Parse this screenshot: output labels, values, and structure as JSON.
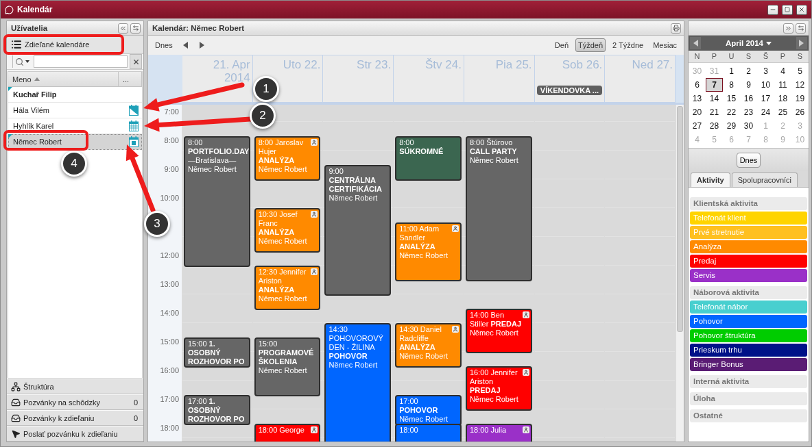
{
  "window": {
    "title": "Kalendár"
  },
  "users_panel": {
    "title": "Užívatelia",
    "shared_button": "Zdieľané kalendáre",
    "columns": [
      "Meno",
      "..."
    ],
    "users": [
      {
        "name": "Kuchař Filip",
        "current": true,
        "marked": true,
        "selected": false,
        "kind": "none"
      },
      {
        "name": "Hála Vilém",
        "current": false,
        "marked": false,
        "selected": false,
        "kind": "shared"
      },
      {
        "name": "Hyhlík Karel",
        "current": false,
        "marked": false,
        "selected": false,
        "kind": "grid"
      },
      {
        "name": "Němec Robert",
        "current": false,
        "marked": true,
        "selected": true,
        "kind": "date"
      }
    ],
    "footer": [
      {
        "label": "Štruktúra",
        "kind": "structure"
      },
      {
        "label": "Pozvánky na schôdzky",
        "count": "0",
        "kind": "inbox"
      },
      {
        "label": "Pozvánky k zdieľaniu",
        "count": "0",
        "kind": "inbox"
      },
      {
        "label": "Poslať pozvánku k zdieľaniu",
        "kind": "send"
      }
    ]
  },
  "calendar": {
    "title": "Kalendár: Němec Robert",
    "today_button": "Dnes",
    "views": [
      {
        "label": "Deň",
        "selected": false
      },
      {
        "label": "Týždeň",
        "selected": true
      },
      {
        "label": "2 Týždne",
        "selected": false
      },
      {
        "label": "Mesiac",
        "selected": false
      }
    ],
    "hours": [
      "7:00",
      "8:00",
      "9:00",
      "10:00",
      "12:00",
      "13:00",
      "14:00",
      "15:00",
      "16:00",
      "17:00",
      "18:00"
    ],
    "days": [
      {
        "label": "21. Apr 2014",
        "events": [
          {
            "time": "8:00",
            "title": "**PORTFOLIO.DAY** —Bratislava—",
            "owner": "Němec Robert",
            "color": "#666666",
            "contact": false
          },
          {
            "time": "15:00",
            "title": "**1. OSOBNÝ ROZHOVOR PO**",
            "color": "#666666",
            "contact": false
          },
          {
            "time": "17:00",
            "title": "**1. OSOBNÝ ROZHOVOR PO**",
            "color": "#666666",
            "contact": false
          }
        ]
      },
      {
        "label": "Uto 22.",
        "events": [
          {
            "time": "8:00",
            "title": "Jaroslav Hujer **ANALÝZA**",
            "owner": "Němec Robert",
            "color": "#ff8a00",
            "contact": true
          },
          {
            "time": "10:30",
            "title": "Josef Franc **ANALÝZA**",
            "owner": "Němec Robert",
            "color": "#ff8a00",
            "contact": true
          },
          {
            "time": "12:30",
            "title": "Jennifer Ariston **ANALÝZA**",
            "owner": "Němec Robert",
            "color": "#ff8a00",
            "contact": true
          },
          {
            "time": "15:00",
            "title": "**PROGRAMOVÉ ŠKOLENIA**",
            "owner": "Němec Robert",
            "color": "#666666",
            "contact": false
          },
          {
            "time": "18:00",
            "title": "George",
            "color": "#ff0000",
            "contact": true
          }
        ]
      },
      {
        "label": "Str 23.",
        "events": [
          {
            "time": "9:00",
            "title": "**CENTRÁLNA CERTIFIKÁCIA**",
            "owner": "Němec Robert",
            "color": "#666666",
            "contact": false
          },
          {
            "time": "14:30",
            "title": "POHOVOROVÝ DEN - ŽILINA **POHOVOR**",
            "owner": "Němec Robert",
            "color": "#0066ff",
            "contact": false
          }
        ]
      },
      {
        "label": "Štv 24.",
        "events": [
          {
            "time": "8:00",
            "title": "**SÚKROMNÉ**",
            "color": "#3b6650",
            "contact": false
          },
          {
            "time": "11:00",
            "title": "Adam Sandler **ANALÝZA**",
            "owner": "Němec Robert",
            "color": "#ff8a00",
            "contact": true
          },
          {
            "time": "14:30",
            "title": "Daniel Radcliffe **ANALÝZA**",
            "owner": "Němec Robert",
            "color": "#ff8a00",
            "contact": true
          },
          {
            "time": "17:00",
            "title": "**POHOVOR**",
            "owner": "Němec Robert",
            "color": "#0066ff",
            "contact": false
          },
          {
            "time": "18:00",
            "color": "#0066ff",
            "contact": false
          }
        ]
      },
      {
        "label": "Pia 25.",
        "events": [
          {
            "time": "8:00",
            "title": "Štúrovo **CALL PARTY**",
            "owner": "Němec Robert",
            "color": "#666666",
            "contact": false
          },
          {
            "time": "14:00",
            "title": "Ben Stiller **PREDAJ**",
            "owner": "Němec Robert",
            "color": "#ff0000",
            "contact": true
          },
          {
            "time": "16:00",
            "title": "Jennifer Ariston **PREDAJ**",
            "owner": "Němec Robert",
            "color": "#ff0000",
            "contact": true
          },
          {
            "time": "18:00",
            "title": "Julia",
            "color": "#9a30c8",
            "contact": true
          }
        ]
      },
      {
        "label": "Sob 26.",
        "all_day": "VÍKENDOVKA ..."
      },
      {
        "label": "Ned 27."
      }
    ]
  },
  "mini_calendar": {
    "month": "April 2014",
    "weekdays": [
      "N",
      "P",
      "U",
      "S",
      "Š",
      "P",
      "S"
    ],
    "days": [
      {
        "day": "30",
        "other": true,
        "selected": false
      },
      {
        "day": "31",
        "other": true,
        "selected": false
      },
      {
        "day": "1",
        "other": false,
        "selected": false
      },
      {
        "day": "2",
        "other": false,
        "selected": false
      },
      {
        "day": "3",
        "other": false,
        "selected": false
      },
      {
        "day": "4",
        "other": false,
        "selected": false
      },
      {
        "day": "5",
        "other": false,
        "selected": false
      },
      {
        "day": "6",
        "other": false,
        "selected": false
      },
      {
        "day": "7",
        "other": false,
        "selected": true
      },
      {
        "day": "8",
        "other": false,
        "selected": false
      },
      {
        "day": "9",
        "other": false,
        "selected": false
      },
      {
        "day": "10",
        "other": false,
        "selected": false
      },
      {
        "day": "11",
        "other": false,
        "selected": false
      },
      {
        "day": "12",
        "other": false,
        "selected": false
      },
      {
        "day": "13",
        "other": false,
        "selected": false
      },
      {
        "day": "14",
        "other": false,
        "selected": false
      },
      {
        "day": "15",
        "other": false,
        "selected": false
      },
      {
        "day": "16",
        "other": false,
        "selected": false
      },
      {
        "day": "17",
        "other": false,
        "selected": false
      },
      {
        "day": "18",
        "other": false,
        "selected": false
      },
      {
        "day": "19",
        "other": false,
        "selected": false
      },
      {
        "day": "20",
        "other": false,
        "selected": false
      },
      {
        "day": "21",
        "other": false,
        "selected": false
      },
      {
        "day": "22",
        "other": false,
        "selected": false
      },
      {
        "day": "23",
        "other": false,
        "selected": false
      },
      {
        "day": "24",
        "other": false,
        "selected": false
      },
      {
        "day": "25",
        "other": false,
        "selected": false
      },
      {
        "day": "26",
        "other": false,
        "selected": false
      },
      {
        "day": "27",
        "other": false,
        "selected": false
      },
      {
        "day": "28",
        "other": false,
        "selected": false
      },
      {
        "day": "29",
        "other": false,
        "selected": false
      },
      {
        "day": "30",
        "other": false,
        "selected": false
      },
      {
        "day": "1",
        "other": true,
        "selected": false
      },
      {
        "day": "2",
        "other": true,
        "selected": false
      },
      {
        "day": "3",
        "other": true,
        "selected": false
      },
      {
        "day": "4",
        "other": true,
        "selected": false
      },
      {
        "day": "5",
        "other": true,
        "selected": false
      },
      {
        "day": "6",
        "other": true,
        "selected": false
      },
      {
        "day": "7",
        "other": true,
        "selected": false
      },
      {
        "day": "8",
        "other": true,
        "selected": false
      },
      {
        "day": "9",
        "other": true,
        "selected": false
      },
      {
        "day": "10",
        "other": true,
        "selected": false
      }
    ],
    "today_button": "Dnes"
  },
  "activities": {
    "tabs": [
      {
        "label": "Aktivity",
        "selected": true
      },
      {
        "label": "Spolupracovníci",
        "selected": false
      }
    ],
    "groups": [
      {
        "title": "Klientská aktivita",
        "items": [
          {
            "label": "Telefonát klient",
            "color": "#ffd400"
          },
          {
            "label": "Prvé stretnutie",
            "color": "#ffc01f"
          },
          {
            "label": "Analýza",
            "color": "#ff8a00"
          },
          {
            "label": "Predaj",
            "color": "#ff0000"
          },
          {
            "label": "Servis",
            "color": "#9a30c8"
          }
        ]
      },
      {
        "title": "Náborová aktivita",
        "items": [
          {
            "label": "Telefonát nábor",
            "color": "#48cfcf"
          },
          {
            "label": "Pohovor",
            "color": "#0066ff"
          },
          {
            "label": "Pohovor štruktúra",
            "color": "#00cc00"
          },
          {
            "label": "Prieskum trhu",
            "color": "#001188"
          },
          {
            "label": "Bringer Bonus",
            "color": "#5a1c74"
          }
        ]
      },
      {
        "title": "Interná aktivita"
      },
      {
        "title": "Úloha"
      },
      {
        "title": "Ostatné"
      }
    ]
  },
  "callouts": [
    {
      "label": "1"
    },
    {
      "label": "2"
    },
    {
      "label": "3"
    },
    {
      "label": "4"
    }
  ]
}
